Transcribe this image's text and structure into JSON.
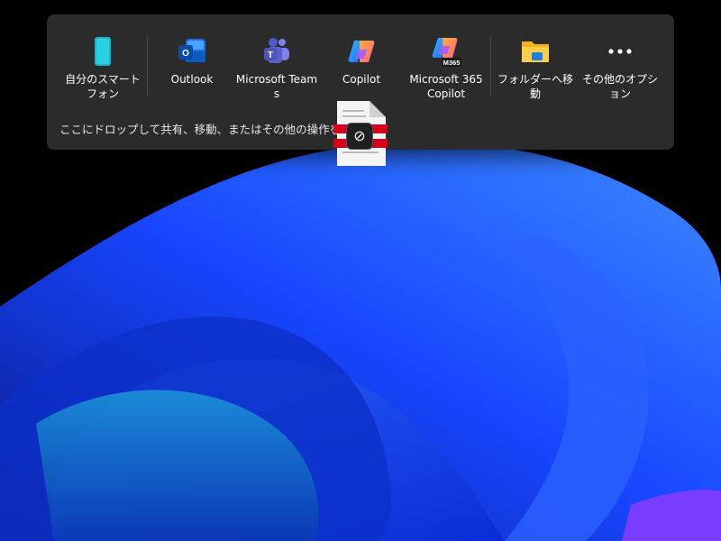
{
  "share_bar": {
    "targets": [
      {
        "label": "自分のスマートフォン",
        "icon": "phone-icon"
      },
      {
        "label": "Outlook",
        "icon": "outlook-icon"
      },
      {
        "label": "Microsoft Teams",
        "icon": "teams-icon"
      },
      {
        "label": "Copilot",
        "icon": "copilot-icon"
      },
      {
        "label": "Microsoft 365 Copilot",
        "icon": "m365-copilot-icon",
        "badge": "M365"
      },
      {
        "label": "フォルダーへ移動",
        "icon": "folder-icon"
      },
      {
        "label": "その他のオプション",
        "icon": "more-icon"
      }
    ],
    "hint": "ここにドロップして共有、移動、またはその他の操作を行い"
  },
  "drag": {
    "cursor": "no-drop-icon",
    "glyph": "⊘"
  },
  "colors": {
    "panel": "#2b2b2b",
    "wallpaper_blue": "#1a4fff",
    "accent_red": "#d6001c"
  }
}
